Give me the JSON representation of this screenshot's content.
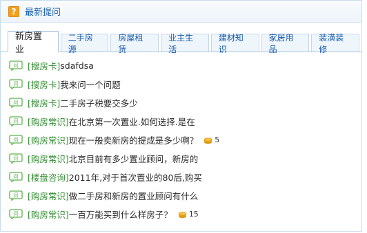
{
  "header": {
    "icon": "question-mark-icon",
    "icon_glyph": "?",
    "title": "最新提问"
  },
  "tabs": [
    {
      "label": "新房置业",
      "active": true
    },
    {
      "label": "二手房源",
      "active": false
    },
    {
      "label": "房屋租赁",
      "active": false
    },
    {
      "label": "业主生活",
      "active": false
    },
    {
      "label": "建材知识",
      "active": false
    },
    {
      "label": "家居用品",
      "active": false
    },
    {
      "label": "装潢装修",
      "active": false
    }
  ],
  "questions": [
    {
      "category": "[搜房卡]",
      "text": "sdafdsa",
      "reward": null
    },
    {
      "category": "[搜房卡]",
      "text": "我来问一个问题",
      "reward": null
    },
    {
      "category": "[搜房卡]",
      "text": "二手房子税要交多少",
      "reward": null
    },
    {
      "category": "[购房常识]",
      "text": "在北京第一次置业.如何选择.是在",
      "reward": null
    },
    {
      "category": "[购房常识]",
      "text": "现在一般卖新房的提成是多少啊？",
      "reward": "5"
    },
    {
      "category": "[购房常识]",
      "text": "北京目前有多少置业顾问，新房的",
      "reward": null
    },
    {
      "category": "[楼盘咨询]",
      "text": "2011年,对于首次置业的80后,购买",
      "reward": null
    },
    {
      "category": "[购房常识]",
      "text": "做二手房和新房的置业顾问有什么",
      "reward": null
    },
    {
      "category": "[购房常识]",
      "text": "一百万能买到什么样房子？",
      "reward": "15"
    }
  ],
  "colors": {
    "accent": "#1a5dab",
    "category": "#2f8c2f",
    "icon_green": "#5bb34a",
    "coin": "#f2b31d"
  }
}
